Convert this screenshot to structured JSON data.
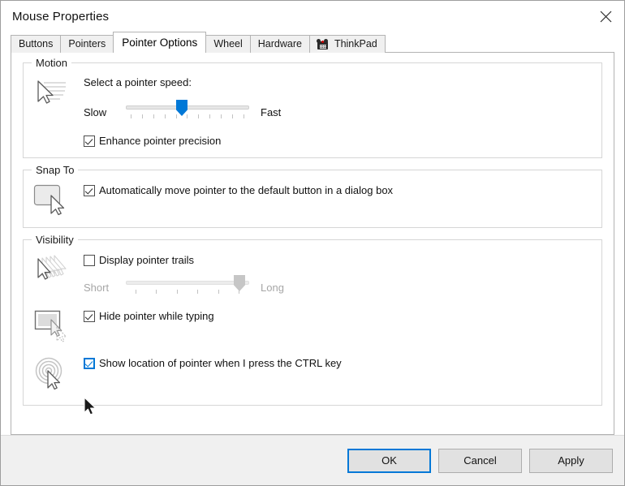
{
  "window": {
    "title": "Mouse Properties",
    "close_icon": "close-icon"
  },
  "tabs": [
    {
      "label": "Buttons",
      "active": false
    },
    {
      "label": "Pointers",
      "active": false
    },
    {
      "label": "Pointer Options",
      "active": true
    },
    {
      "label": "Wheel",
      "active": false
    },
    {
      "label": "Hardware",
      "active": false
    },
    {
      "label": "ThinkPad",
      "active": false,
      "icon": "thinkpad-icon"
    }
  ],
  "motion": {
    "legend": "Motion",
    "icon": "pointer-speed-icon",
    "speed_label": "Select a pointer speed:",
    "slider": {
      "min_label": "Slow",
      "max_label": "Fast",
      "value_percent": 50,
      "tick_count": 11,
      "enabled": true
    },
    "enhance_precision": {
      "label": "Enhance pointer precision",
      "checked": true
    }
  },
  "snap_to": {
    "legend": "Snap To",
    "icon": "default-button-icon",
    "auto_move": {
      "label": "Automatically move pointer to the default button in a dialog box",
      "checked": true
    }
  },
  "visibility": {
    "legend": "Visibility",
    "trails": {
      "icon": "pointer-trails-icon",
      "label": "Display pointer trails",
      "checked": false,
      "slider": {
        "min_label": "Short",
        "max_label": "Long",
        "value_percent": 100,
        "tick_count": 6,
        "enabled": false
      }
    },
    "hide_typing": {
      "icon": "hide-pointer-icon",
      "label": "Hide pointer while typing",
      "checked": true
    },
    "show_location": {
      "icon": "ctrl-locate-icon",
      "label": "Show location of pointer when I press the CTRL key",
      "checked": true,
      "hovered": true
    }
  },
  "footer": {
    "ok_label": "OK",
    "cancel_label": "Cancel",
    "apply_label": "Apply"
  },
  "colors": {
    "accent": "#0078d7",
    "dialog_bg": "#ffffff",
    "footer_bg": "#f0f0f0",
    "group_border": "#d6d6d6"
  }
}
